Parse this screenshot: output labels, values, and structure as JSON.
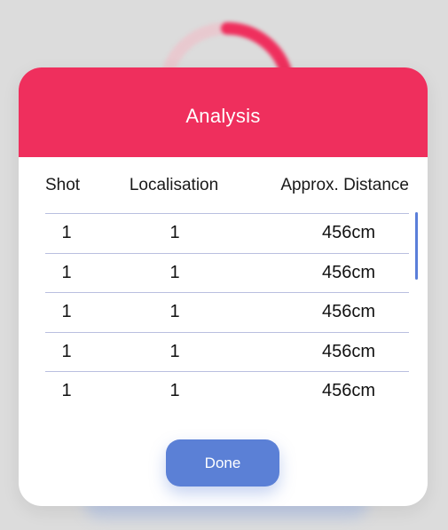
{
  "modal": {
    "title": "Analysis",
    "columns": {
      "shot": "Shot",
      "localisation": "Localisation",
      "distance": "Approx. Distance"
    },
    "rows": [
      {
        "shot": "1",
        "localisation": "1",
        "distance": "456cm"
      },
      {
        "shot": "1",
        "localisation": "1",
        "distance": "456cm"
      },
      {
        "shot": "1",
        "localisation": "1",
        "distance": "456cm"
      },
      {
        "shot": "1",
        "localisation": "1",
        "distance": "456cm"
      },
      {
        "shot": "1",
        "localisation": "1",
        "distance": "456cm"
      }
    ],
    "done_label": "Done"
  },
  "colors": {
    "header": "#ef2f5d",
    "button": "#5b80d6",
    "divider": "#b9bfe0",
    "scrollbar": "#5b7fd9"
  }
}
